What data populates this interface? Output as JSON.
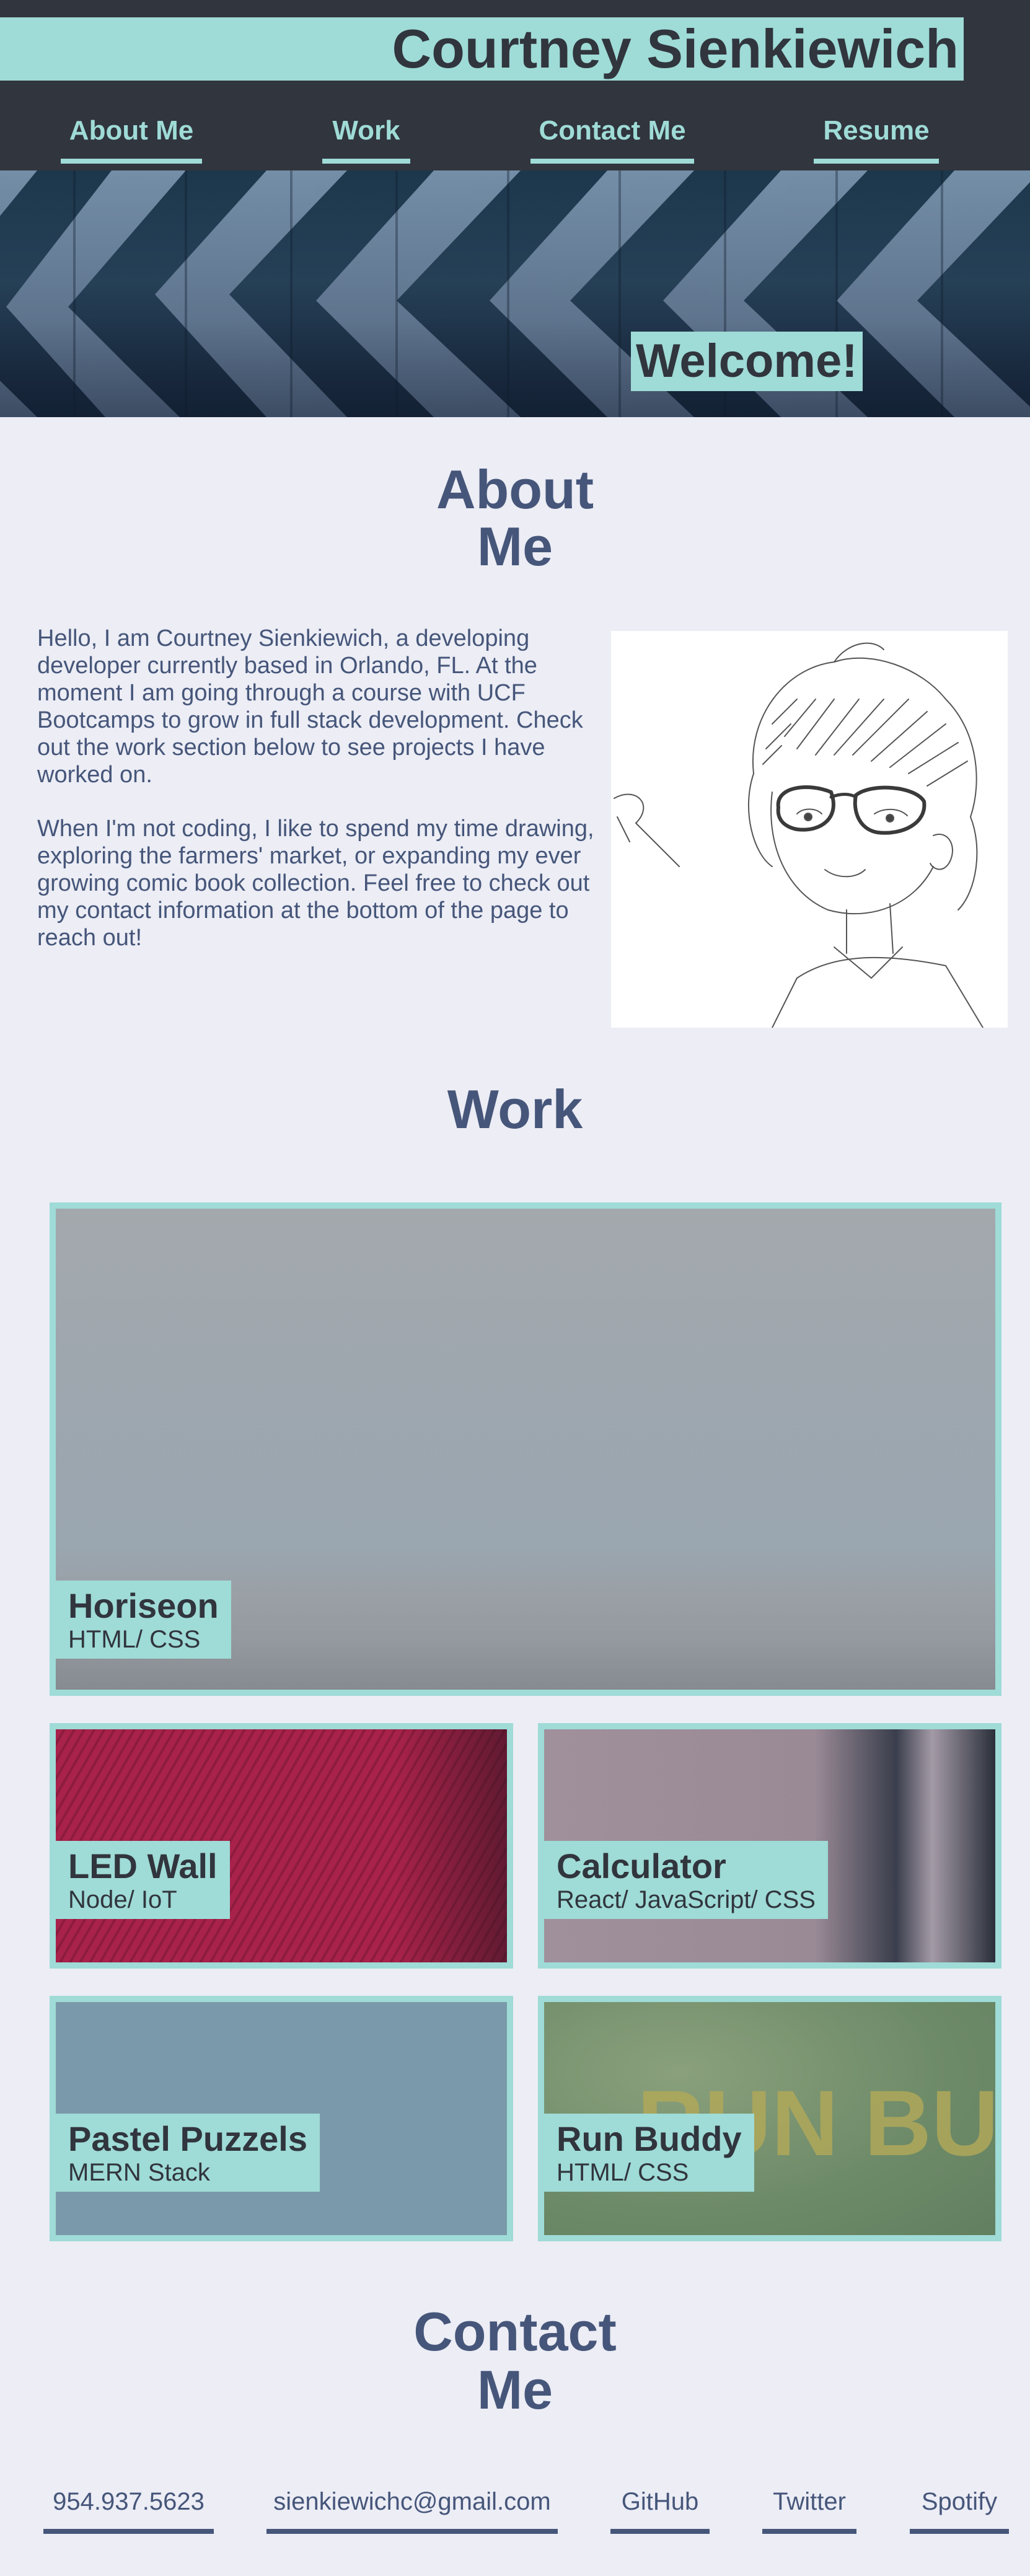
{
  "header": {
    "title": "Courtney Sienkiewich",
    "nav": [
      "About Me",
      "Work",
      "Contact Me",
      "Resume"
    ]
  },
  "hero": {
    "welcome": "Welcome!"
  },
  "about": {
    "heading_line1": "About",
    "heading_line2": "Me",
    "paragraph1": "Hello, I am Courtney Sienkiewich, a developing developer currently based in Orlando, FL. At the moment I am going through a course with UCF Bootcamps to grow in full stack development. Check out the work section below to see projects I have worked on.",
    "paragraph2": "When I'm not coding, I like to spend my time drawing, exploring the farmers' market, or expanding my ever growing comic book collection. Feel free to check out my contact information at the bottom of the page to reach out!"
  },
  "work": {
    "heading": "Work",
    "projects": [
      {
        "name": "Horiseon",
        "tech": "HTML/ CSS"
      },
      {
        "name": "LED Wall",
        "tech": "Node/ IoT"
      },
      {
        "name": "Calculator",
        "tech": "React/ JavaScript/ CSS"
      },
      {
        "name": "Pastel Puzzels",
        "tech": "MERN Stack"
      },
      {
        "name": "Run Buddy",
        "tech": "HTML/ CSS",
        "image_text": "RUN BU"
      }
    ]
  },
  "contact": {
    "heading_line1": "Contact",
    "heading_line2": "Me",
    "links": [
      "954.937.5623",
      "sienkiewichc@gmail.com",
      "GitHub",
      "Twitter",
      "Spotify"
    ]
  },
  "colors": {
    "page_bg": "#ecedf5",
    "header_bg": "#31353d",
    "accent": "#9fdbd7",
    "text": "#46567a"
  }
}
